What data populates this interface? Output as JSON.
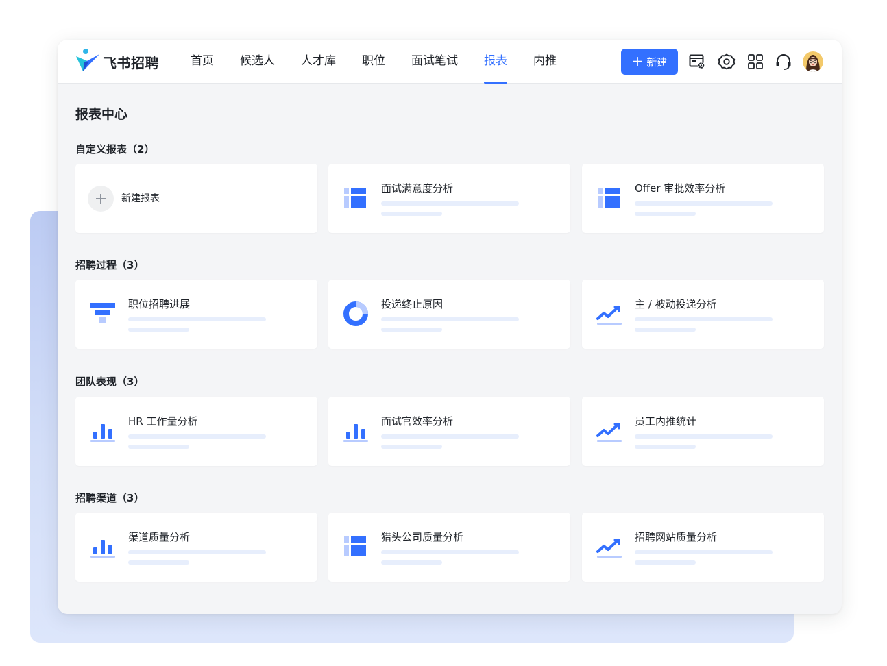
{
  "brand": {
    "name": "飞书招聘"
  },
  "nav": {
    "items": [
      {
        "label": "首页",
        "active": false
      },
      {
        "label": "候选人",
        "active": false
      },
      {
        "label": "人才库",
        "active": false
      },
      {
        "label": "职位",
        "active": false
      },
      {
        "label": "面试笔试",
        "active": false
      },
      {
        "label": "报表",
        "active": true
      },
      {
        "label": "内推",
        "active": false
      }
    ]
  },
  "toolbar": {
    "new_label": "新建",
    "icons": [
      "report-settings-icon",
      "gear-icon",
      "apps-grid-icon",
      "headset-icon",
      "user-avatar"
    ]
  },
  "page": {
    "title": "报表中心"
  },
  "sections": [
    {
      "title": "自定义报表（2）",
      "cards": [
        {
          "name": "新建报表",
          "icon": "plus-icon",
          "is_new": true
        },
        {
          "name": "面试满意度分析",
          "icon": "table-icon"
        },
        {
          "name": "Offer 审批效率分析",
          "icon": "table-icon"
        }
      ]
    },
    {
      "title": "招聘过程（3）",
      "cards": [
        {
          "name": "职位招聘进展",
          "icon": "funnel-icon"
        },
        {
          "name": "投递终止原因",
          "icon": "donut-chart-icon"
        },
        {
          "name": "主 / 被动投递分析",
          "icon": "trend-line-icon"
        }
      ]
    },
    {
      "title": "团队表现（3）",
      "cards": [
        {
          "name": "HR 工作量分析",
          "icon": "bar-chart-icon"
        },
        {
          "name": "面试官效率分析",
          "icon": "bar-chart-icon"
        },
        {
          "name": "员工内推统计",
          "icon": "trend-line-icon"
        }
      ]
    },
    {
      "title": "招聘渠道（3）",
      "cards": [
        {
          "name": "渠道质量分析",
          "icon": "bar-chart-icon"
        },
        {
          "name": "猎头公司质量分析",
          "icon": "table-icon"
        },
        {
          "name": "招聘网站质量分析",
          "icon": "trend-line-icon"
        }
      ]
    }
  ],
  "colors": {
    "accent": "#3370ff",
    "accent_light": "#b8cbff",
    "placeholder_bar": "#e7eefc",
    "canvas": "#f4f5f7",
    "backdrop": "#c9d6f6"
  }
}
